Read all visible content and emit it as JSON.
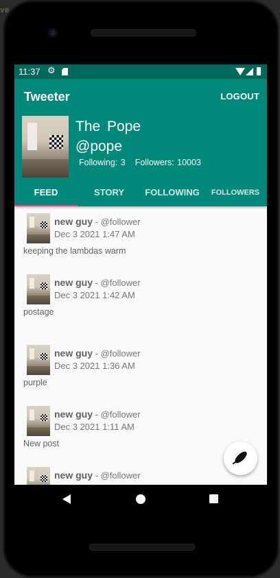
{
  "status_bar": {
    "time": "11:37"
  },
  "app_bar": {
    "title": "Tweeter",
    "logout_label": "LOGOUT"
  },
  "profile": {
    "name": "The  Pope",
    "alias": "@pope",
    "following": "Following: 3",
    "followers": "Followers: 10003"
  },
  "tabs": [
    {
      "label": "FEED",
      "active": true
    },
    {
      "label": "STORY",
      "active": false
    },
    {
      "label": "FOLLOWING",
      "active": false
    },
    {
      "label": "FOLLOWERS",
      "active": false
    }
  ],
  "feed": [
    {
      "user": "new guy",
      "alias": " - @follower",
      "date": "Dec 3 2021 1:47 AM",
      "body": "keeping the lambdas warm"
    },
    {
      "user": "new guy",
      "alias": " - @follower",
      "date": "Dec 3 2021 1:42 AM",
      "body": "postage"
    },
    {
      "user": "new guy",
      "alias": " - @follower",
      "date": "Dec 3 2021 1:36 AM",
      "body": "purple"
    },
    {
      "user": "new guy",
      "alias": " - @follower",
      "date": "Dec 3 2021 1:11 AM",
      "body": "New post"
    },
    {
      "user": "new guy",
      "alias": " - @follower",
      "date": "",
      "body": ""
    }
  ],
  "icons": {
    "status": [
      "settings-icon",
      "sd-card-icon",
      "wifi-icon",
      "cell-signal-icon",
      "battery-icon"
    ],
    "fab": "feather-icon",
    "nav": [
      "back-icon",
      "home-icon",
      "recents-icon"
    ]
  },
  "colors": {
    "primary": "#00897b",
    "primary_dark": "#00695c",
    "tab_indicator": "#ff4081",
    "background": "#fafafa"
  }
}
